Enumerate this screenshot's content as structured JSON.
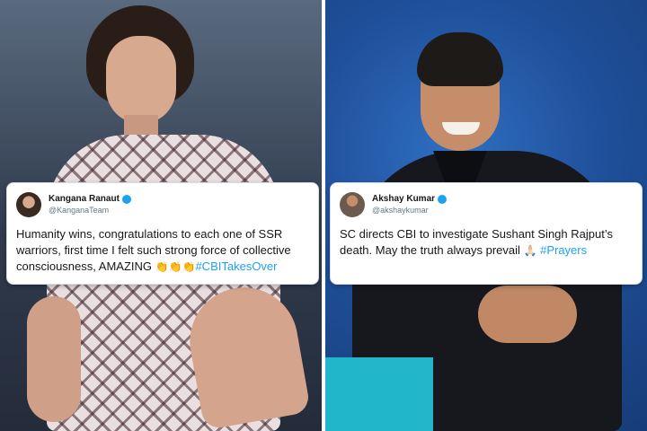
{
  "left_tweet": {
    "name": "Kangana Ranaut",
    "handle": "@KanganaTeam",
    "text": "Humanity wins, congratulations to each one of SSR warriors, first time I felt such strong force of collective consciousness, AMAZING",
    "emoji": "👏👏👏",
    "hashtag": "#CBITakesOver"
  },
  "right_tweet": {
    "name": "Akshay Kumar",
    "handle": "@akshaykumar",
    "text": "SC directs CBI to investigate Sushant Singh Rajput’s death. May the truth always prevail",
    "emoji": "🙏🏻",
    "hashtag": "#Prayers"
  },
  "colors": {
    "hashtag": "#1da1f2",
    "verified": "#1da1f2",
    "left_background": "#2f3a4c",
    "right_background": "#1f4f99"
  }
}
